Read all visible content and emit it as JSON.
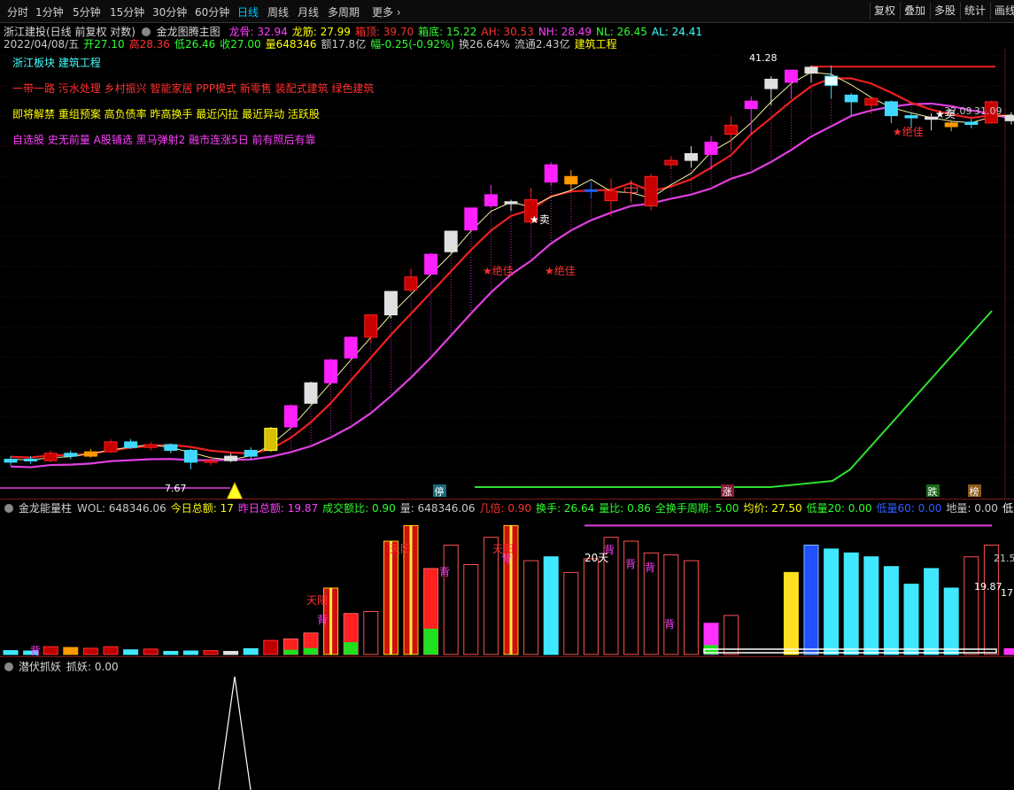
{
  "toolbar": {
    "tabs": [
      "分时",
      "1分钟",
      "5分钟",
      "15分钟",
      "30分钟",
      "60分钟",
      "日线",
      "周线",
      "月线",
      "多周期",
      "更多"
    ],
    "active": "日线",
    "right": [
      "复权",
      "叠加",
      "多股",
      "统计",
      "画线"
    ]
  },
  "info1": {
    "name": "浙江建投(日线 前复权 对数)",
    "indicator": "金龙图腾主图",
    "items": [
      {
        "t": "龙骨: 32.94",
        "c": "#ff40ff"
      },
      {
        "t": "龙筋: 27.99",
        "c": "#ffff00"
      },
      {
        "t": "箱顶: 39.70",
        "c": "#ff3030"
      },
      {
        "t": "箱底: 15.22",
        "c": "#30ff30"
      },
      {
        "t": "AH: 30.53",
        "c": "#ff3030"
      },
      {
        "t": "NH: 28.49",
        "c": "#ff40ff"
      },
      {
        "t": "NL: 26.45",
        "c": "#30ff30"
      },
      {
        "t": "AL: 24.41",
        "c": "#40ffff"
      }
    ]
  },
  "info2": {
    "items": [
      {
        "t": "2022/04/08/五",
        "c": "#c8c8c8"
      },
      {
        "t": "开27.10",
        "c": "#30ff30"
      },
      {
        "t": "高28.36",
        "c": "#ff3030"
      },
      {
        "t": "低26.46",
        "c": "#30ff30"
      },
      {
        "t": "收27.00",
        "c": "#30ff30"
      },
      {
        "t": "量648346",
        "c": "#ffff00"
      },
      {
        "t": "额17.8亿",
        "c": "#c8c8c8"
      },
      {
        "t": "幅-0.25(-0.92%)",
        "c": "#30ff30"
      },
      {
        "t": "换26.64%",
        "c": "#c8c8c8"
      },
      {
        "t": "流通2.43亿",
        "c": "#c8c8c8"
      },
      {
        "t": "建筑工程",
        "c": "#ffff00"
      }
    ]
  },
  "notes": [
    {
      "t": "浙江板块 建筑工程",
      "c": "#40ffff"
    },
    {
      "t": "一带一路 污水处理 乡村振兴 智能家居 PPP模式 新零售 装配式建筑 绿色建筑",
      "c": "#ff3030"
    },
    {
      "t": "即将解禁 重组预案 高负债率 昨高换手 最近闪拉 最近异动 活跃股",
      "c": "#ffff00"
    },
    {
      "t": "自选股 史无前量 A股铺选 黑马弹射2 融市连涨5日 前有照后有靠",
      "c": "#ff40ff"
    }
  ],
  "chart_labels": {
    "sell": "★卖",
    "jue": "★绝佳",
    "low_price": "7.67",
    "high_price": "41.28",
    "ting": "停",
    "zhang": "涨",
    "die": "跌",
    "bang": "榜",
    "r1": "32.09",
    "r2": "31.09"
  },
  "vol_header": {
    "name": "金龙能量柱",
    "items": [
      {
        "t": "WOL: 648346.06",
        "c": "#c8c8c8"
      },
      {
        "t": "今日总额: 17",
        "c": "#ffff00"
      },
      {
        "t": "昨日总额: 19.87",
        "c": "#ff40ff"
      },
      {
        "t": "成交额比: 0.90",
        "c": "#30ff30"
      },
      {
        "t": "量: 648346.06",
        "c": "#c8c8c8"
      },
      {
        "t": "几倍: 0.90",
        "c": "#ff3030"
      },
      {
        "t": "换手: 26.64",
        "c": "#30ff30"
      },
      {
        "t": "量比: 0.86",
        "c": "#30ff30"
      },
      {
        "t": "全换手周期: 5.00",
        "c": "#30ff30"
      },
      {
        "t": "均价: 27.50",
        "c": "#ffff00"
      },
      {
        "t": "低量20: 0.00",
        "c": "#30ff30"
      },
      {
        "t": "低量60: 0.00",
        "c": "#3060ff"
      },
      {
        "t": "地量: 0.00",
        "c": "#c8c8c8"
      },
      {
        "t": "低量柱: 4330",
        "c": "#ffffff"
      }
    ]
  },
  "vol_labels": {
    "tianyang": "天阳",
    "bei": "背",
    "d20": "20天",
    "lv": "21.5",
    "lv2": "19.87",
    "lv3": "17.8"
  },
  "bottom_header": {
    "name": "潜伏抓妖",
    "item": "抓妖: 0.00"
  },
  "chart_data": {
    "type": "candlestick",
    "candles": [
      {
        "o": 7.9,
        "c": 8.0,
        "h": 8.1,
        "l": 7.8,
        "k": "cyan"
      },
      {
        "o": 8.0,
        "c": 7.95,
        "h": 8.1,
        "l": 7.85,
        "k": "cyan"
      },
      {
        "o": 7.95,
        "c": 8.2,
        "h": 8.3,
        "l": 7.9,
        "k": "red"
      },
      {
        "o": 8.2,
        "c": 8.1,
        "h": 8.3,
        "l": 8.0,
        "k": "cyan"
      },
      {
        "o": 8.1,
        "c": 8.25,
        "h": 8.35,
        "l": 8.05,
        "k": "orange"
      },
      {
        "o": 8.25,
        "c": 8.6,
        "h": 8.7,
        "l": 8.2,
        "k": "red"
      },
      {
        "o": 8.6,
        "c": 8.4,
        "h": 8.7,
        "l": 8.35,
        "k": "cyan"
      },
      {
        "o": 8.4,
        "c": 8.5,
        "h": 8.6,
        "l": 8.3,
        "k": "red"
      },
      {
        "o": 8.5,
        "c": 8.3,
        "h": 8.55,
        "l": 8.2,
        "k": "cyan"
      },
      {
        "o": 8.3,
        "c": 7.9,
        "h": 8.35,
        "l": 7.67,
        "k": "cyan"
      },
      {
        "o": 7.9,
        "c": 7.95,
        "h": 8.1,
        "l": 7.8,
        "k": "red"
      },
      {
        "o": 7.95,
        "c": 8.1,
        "h": 8.2,
        "l": 7.9,
        "k": "white"
      },
      {
        "o": 8.1,
        "c": 8.3,
        "h": 8.4,
        "l": 8.0,
        "k": "cyan"
      },
      {
        "o": 8.3,
        "c": 9.1,
        "h": 9.15,
        "l": 8.25,
        "k": "gold"
      },
      {
        "o": 9.15,
        "c": 10.0,
        "h": 10.05,
        "l": 9.1,
        "k": "mag"
      },
      {
        "o": 10.1,
        "c": 11.0,
        "h": 11.05,
        "l": 10.05,
        "k": "white"
      },
      {
        "o": 11.0,
        "c": 12.1,
        "h": 12.15,
        "l": 10.9,
        "k": "mag"
      },
      {
        "o": 12.2,
        "c": 13.3,
        "h": 13.35,
        "l": 12.1,
        "k": "mag"
      },
      {
        "o": 13.3,
        "c": 14.6,
        "h": 14.6,
        "l": 13.0,
        "k": "red"
      },
      {
        "o": 14.6,
        "c": 16.1,
        "h": 16.1,
        "l": 14.4,
        "k": "white"
      },
      {
        "o": 16.2,
        "c": 17.1,
        "h": 17.7,
        "l": 16.0,
        "k": "red"
      },
      {
        "o": 17.3,
        "c": 18.8,
        "h": 18.9,
        "l": 17.2,
        "k": "mag"
      },
      {
        "o": 19.0,
        "c": 20.7,
        "h": 20.7,
        "l": 18.9,
        "k": "white"
      },
      {
        "o": 20.8,
        "c": 22.8,
        "h": 22.8,
        "l": 20.7,
        "k": "mag"
      },
      {
        "o": 23.0,
        "c": 24.1,
        "h": 25.1,
        "l": 22.8,
        "k": "mag"
      },
      {
        "o": 23.4,
        "c": 23.2,
        "h": 23.6,
        "l": 22.5,
        "k": "white"
      },
      {
        "o": 23.6,
        "c": 21.5,
        "h": 24.8,
        "l": 21.3,
        "k": "red"
      },
      {
        "o": 25.4,
        "c": 27.3,
        "h": 27.6,
        "l": 25.0,
        "k": "mag"
      },
      {
        "o": 26.0,
        "c": 25.2,
        "h": 26.7,
        "l": 24.6,
        "k": "orange"
      },
      {
        "o": 24.5,
        "c": 24.6,
        "h": 25.5,
        "l": 23.7,
        "k": "blue"
      },
      {
        "o": 24.5,
        "c": 23.5,
        "h": 25.8,
        "l": 22.0,
        "k": "red"
      },
      {
        "o": 24.3,
        "c": 24.8,
        "h": 25.6,
        "l": 23.4,
        "k": "hollow"
      },
      {
        "o": 26.0,
        "c": 23.0,
        "h": 26.3,
        "l": 22.6,
        "k": "red"
      },
      {
        "o": 27.3,
        "c": 27.8,
        "h": 28.3,
        "l": 26.8,
        "k": "red"
      },
      {
        "o": 27.8,
        "c": 28.6,
        "h": 29.5,
        "l": 27.0,
        "k": "white"
      },
      {
        "o": 28.5,
        "c": 30.0,
        "h": 30.8,
        "l": 26.7,
        "k": "mag"
      },
      {
        "o": 31.0,
        "c": 32.2,
        "h": 33.4,
        "l": 29.0,
        "k": "red"
      },
      {
        "o": 34.5,
        "c": 35.6,
        "h": 36.3,
        "l": 31.0,
        "k": "mag"
      },
      {
        "o": 37.5,
        "c": 39.0,
        "h": 39.5,
        "l": 35.0,
        "k": "white"
      },
      {
        "o": 38.5,
        "c": 40.5,
        "h": 40.6,
        "l": 36.0,
        "k": "mag"
      },
      {
        "o": 40.0,
        "c": 41.0,
        "h": 41.3,
        "l": 38.5,
        "k": "white"
      },
      {
        "o": 39.5,
        "c": 38.0,
        "h": 41.28,
        "l": 36.0,
        "k": "cyanw"
      },
      {
        "o": 36.5,
        "c": 35.5,
        "h": 36.8,
        "l": 33.5,
        "k": "cyan"
      },
      {
        "o": 36.0,
        "c": 35.0,
        "h": 36.2,
        "l": 33.8,
        "k": "red"
      },
      {
        "o": 35.5,
        "c": 33.5,
        "h": 35.7,
        "l": 32.5,
        "k": "cyan"
      },
      {
        "o": 33.5,
        "c": 33.2,
        "h": 34.0,
        "l": 31.8,
        "k": "cyan"
      },
      {
        "o": 33.3,
        "c": 33.0,
        "h": 33.8,
        "l": 31.5,
        "k": "white"
      },
      {
        "o": 32.5,
        "c": 32.0,
        "h": 32.8,
        "l": 31.4,
        "k": "orange"
      },
      {
        "o": 32.3,
        "c": 32.6,
        "h": 33.0,
        "l": 31.8,
        "k": "cyan"
      },
      {
        "o": 32.5,
        "c": 35.5,
        "h": 35.7,
        "l": 32.4,
        "k": "red"
      },
      {
        "o": 33.5,
        "c": 32.8,
        "h": 34.0,
        "l": 32.3,
        "k": "white"
      },
      {
        "o": 31.0,
        "c": 30.0,
        "h": 32.0,
        "l": 29.7,
        "k": "hollow"
      },
      {
        "o": 29.0,
        "c": 28.2,
        "h": 29.6,
        "l": 26.5,
        "k": "cyan"
      },
      {
        "o": 27.1,
        "c": 27.0,
        "h": 28.36,
        "l": 26.46,
        "k": "cyan"
      }
    ],
    "volumes": [
      {
        "v": 10,
        "k": "cyan"
      },
      {
        "v": 9,
        "k": "cyan"
      },
      {
        "v": 20,
        "k": "red"
      },
      {
        "v": 18,
        "k": "orange"
      },
      {
        "v": 16,
        "k": "red"
      },
      {
        "v": 20,
        "k": "red"
      },
      {
        "v": 12,
        "k": "cyan"
      },
      {
        "v": 14,
        "k": "red"
      },
      {
        "v": 8,
        "k": "cyan"
      },
      {
        "v": 9,
        "k": "cyan"
      },
      {
        "v": 10,
        "k": "red"
      },
      {
        "v": 8,
        "k": "white"
      },
      {
        "v": 15,
        "k": "cyan"
      },
      {
        "v": 36,
        "k": "red"
      },
      {
        "v": 40,
        "k": "mix"
      },
      {
        "v": 55,
        "k": "mix"
      },
      {
        "v": 170,
        "k": "grad"
      },
      {
        "v": 105,
        "k": "mix"
      },
      {
        "v": 110,
        "k": "hollow"
      },
      {
        "v": 290,
        "k": "grad"
      },
      {
        "v": 330,
        "k": "grad"
      },
      {
        "v": 220,
        "k": "mix"
      },
      {
        "v": 280,
        "k": "hollow"
      },
      {
        "v": 230,
        "k": "hollow"
      },
      {
        "v": 300,
        "k": "hollow"
      },
      {
        "v": 330,
        "k": "grad"
      },
      {
        "v": 240,
        "k": "hollow"
      },
      {
        "v": 250,
        "k": "cyan"
      },
      {
        "v": 210,
        "k": "hollow"
      },
      {
        "v": 245,
        "k": "hollow"
      },
      {
        "v": 300,
        "k": "hollow"
      },
      {
        "v": 290,
        "k": "hollow"
      },
      {
        "v": 260,
        "k": "hollow"
      },
      {
        "v": 255,
        "k": "hollow"
      },
      {
        "v": 240,
        "k": "hollow"
      },
      {
        "v": 80,
        "k": "mix2"
      },
      {
        "v": 100,
        "k": "hollow"
      },
      {
        "v": 0,
        "k": "none"
      },
      {
        "v": 0,
        "k": "none"
      },
      {
        "v": 210,
        "k": "yellow"
      },
      {
        "v": 280,
        "k": "blue"
      },
      {
        "v": 270,
        "k": "cyan"
      },
      {
        "v": 260,
        "k": "cyan"
      },
      {
        "v": 250,
        "k": "cyan"
      },
      {
        "v": 225,
        "k": "cyan"
      },
      {
        "v": 180,
        "k": "cyan"
      },
      {
        "v": 220,
        "k": "cyan"
      },
      {
        "v": 170,
        "k": "cyan"
      },
      {
        "v": 250,
        "k": "hollow"
      },
      {
        "v": 280,
        "k": "hollow"
      },
      {
        "v": 15,
        "k": "mag"
      },
      {
        "v": 210,
        "k": "yellow"
      },
      {
        "v": 200,
        "k": "cyan"
      },
      {
        "v": 190,
        "k": "cyan"
      }
    ]
  }
}
